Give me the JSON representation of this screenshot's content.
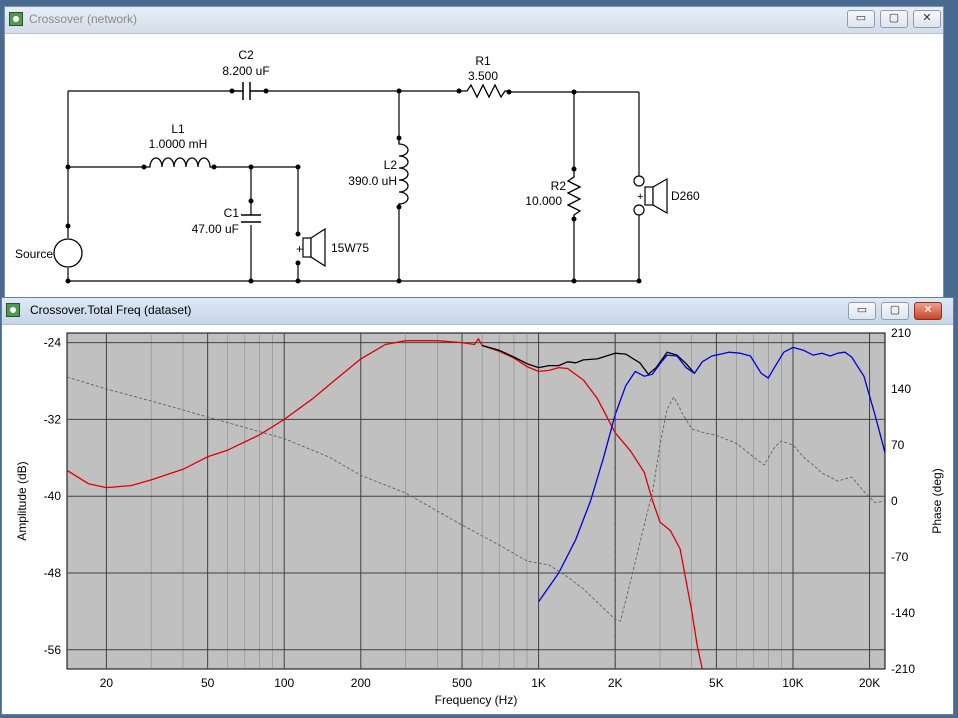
{
  "network_window": {
    "title": "Crossover (network)",
    "components": {
      "c2": {
        "name": "C2",
        "value": "8.200 uF"
      },
      "r1": {
        "name": "R1",
        "value": "3.500"
      },
      "l1": {
        "name": "L1",
        "value": "1.0000 mH"
      },
      "l2": {
        "name": "L2",
        "value": "390.0 uH"
      },
      "c1": {
        "name": "C1",
        "value": "47.00 uF"
      },
      "r2": {
        "name": "R2",
        "value": "10.000"
      },
      "source": {
        "name": "Source"
      },
      "woofer": {
        "name": "15W75"
      },
      "tweeter": {
        "name": "D260"
      }
    }
  },
  "plot_window": {
    "title": "Crossover.Total Freq (dataset)"
  },
  "window_buttons": {
    "minimize": "▭",
    "maximize": "▢",
    "close": "✕"
  },
  "chart_data": {
    "type": "line",
    "xlabel": "Frequency (Hz)",
    "ylabel_left": "Amplitude (dB)",
    "ylabel_right": "Phase (deg)",
    "x_scale": "log",
    "xlim": [
      14,
      23000
    ],
    "ylim_left": [
      -58,
      -23
    ],
    "ylim_right": [
      -210,
      210
    ],
    "x_ticks": [
      {
        "v": 20,
        "label": "20"
      },
      {
        "v": 50,
        "label": "50"
      },
      {
        "v": 100,
        "label": "100"
      },
      {
        "v": 200,
        "label": "200"
      },
      {
        "v": 500,
        "label": "500"
      },
      {
        "v": 1000,
        "label": "1K"
      },
      {
        "v": 2000,
        "label": "2K"
      },
      {
        "v": 5000,
        "label": "5K"
      },
      {
        "v": 10000,
        "label": "10K"
      },
      {
        "v": 20000,
        "label": "20K"
      }
    ],
    "y_ticks_left": [
      {
        "v": -24,
        "label": "-24"
      },
      {
        "v": -32,
        "label": "-32"
      },
      {
        "v": -40,
        "label": "-40"
      },
      {
        "v": -48,
        "label": "-48"
      },
      {
        "v": -56,
        "label": "-56"
      }
    ],
    "y_ticks_right": [
      {
        "v": 210,
        "label": "210"
      },
      {
        "v": 140,
        "label": "140"
      },
      {
        "v": 70,
        "label": "70"
      },
      {
        "v": 0,
        "label": "0"
      },
      {
        "v": -70,
        "label": "-70"
      },
      {
        "v": -140,
        "label": "-140"
      },
      {
        "v": -210,
        "label": "-210"
      }
    ],
    "grid": true,
    "background": "#c0c0c0",
    "series": [
      {
        "color": "#e00000",
        "axis": "left",
        "style": "solid",
        "points": [
          [
            14,
            -37.3
          ],
          [
            17,
            -38.7
          ],
          [
            20,
            -39.1
          ],
          [
            25,
            -38.9
          ],
          [
            30,
            -38.3
          ],
          [
            40,
            -37.2
          ],
          [
            50,
            -35.9
          ],
          [
            60,
            -35.2
          ],
          [
            80,
            -33.6
          ],
          [
            100,
            -32.0
          ],
          [
            130,
            -29.8
          ],
          [
            160,
            -27.8
          ],
          [
            200,
            -25.7
          ],
          [
            250,
            -24.2
          ],
          [
            300,
            -23.8
          ],
          [
            400,
            -23.8
          ],
          [
            500,
            -24.0
          ],
          [
            560,
            -24.2
          ],
          [
            580,
            -23.6
          ],
          [
            600,
            -24.3
          ],
          [
            700,
            -24.9
          ],
          [
            800,
            -25.6
          ],
          [
            900,
            -26.5
          ],
          [
            1000,
            -27.0
          ],
          [
            1100,
            -26.9
          ],
          [
            1200,
            -26.6
          ],
          [
            1300,
            -26.7
          ],
          [
            1500,
            -27.9
          ],
          [
            1700,
            -29.8
          ],
          [
            2000,
            -33.4
          ],
          [
            2300,
            -35.3
          ],
          [
            2600,
            -37.5
          ],
          [
            2800,
            -40.4
          ],
          [
            3000,
            -42.7
          ],
          [
            3300,
            -43.6
          ],
          [
            3600,
            -45.5
          ],
          [
            4000,
            -52.0
          ],
          [
            4200,
            -55.5
          ],
          [
            4400,
            -58.0
          ]
        ]
      },
      {
        "color": "#000000",
        "axis": "left",
        "style": "solid",
        "points": [
          [
            600,
            -24.3
          ],
          [
            700,
            -24.8
          ],
          [
            800,
            -25.5
          ],
          [
            900,
            -26.2
          ],
          [
            1000,
            -26.6
          ],
          [
            1100,
            -26.4
          ],
          [
            1200,
            -26.4
          ],
          [
            1300,
            -26.0
          ],
          [
            1400,
            -26.1
          ],
          [
            1500,
            -25.8
          ],
          [
            1700,
            -25.7
          ],
          [
            2000,
            -25.1
          ],
          [
            2200,
            -25.2
          ],
          [
            2500,
            -26.1
          ],
          [
            2700,
            -27.3
          ],
          [
            2900,
            -26.6
          ],
          [
            3200,
            -25.0
          ],
          [
            3500,
            -25.3
          ],
          [
            3800,
            -26.2
          ],
          [
            4100,
            -27.2
          ]
        ]
      },
      {
        "color": "#0000e0",
        "axis": "left",
        "style": "solid",
        "points": [
          [
            1000,
            -51.0
          ],
          [
            1200,
            -48.0
          ],
          [
            1400,
            -44.5
          ],
          [
            1600,
            -40.5
          ],
          [
            1800,
            -36.0
          ],
          [
            2000,
            -31.5
          ],
          [
            2200,
            -28.5
          ],
          [
            2400,
            -27.0
          ],
          [
            2600,
            -27.5
          ],
          [
            2800,
            -27.3
          ],
          [
            3000,
            -26.2
          ],
          [
            3200,
            -25.3
          ],
          [
            3500,
            -25.4
          ],
          [
            3800,
            -26.6
          ],
          [
            4100,
            -27.2
          ],
          [
            4400,
            -26.0
          ],
          [
            4800,
            -25.4
          ],
          [
            5200,
            -25.2
          ],
          [
            5600,
            -25.0
          ],
          [
            6200,
            -25.1
          ],
          [
            6800,
            -25.4
          ],
          [
            7500,
            -27.2
          ],
          [
            8000,
            -27.7
          ],
          [
            8500,
            -26.5
          ],
          [
            9200,
            -25.0
          ],
          [
            10000,
            -24.5
          ],
          [
            11000,
            -24.8
          ],
          [
            12000,
            -25.3
          ],
          [
            13000,
            -25.1
          ],
          [
            14000,
            -25.4
          ],
          [
            15000,
            -25.1
          ],
          [
            16000,
            -25.0
          ],
          [
            17000,
            -25.5
          ],
          [
            19000,
            -27.5
          ],
          [
            21000,
            -31.5
          ],
          [
            22500,
            -34.5
          ],
          [
            23000,
            -35.5
          ]
        ]
      },
      {
        "color": "#606060",
        "axis": "right",
        "style": "dashed",
        "points": [
          [
            14,
            155
          ],
          [
            20,
            140
          ],
          [
            30,
            125
          ],
          [
            50,
            105
          ],
          [
            100,
            78
          ],
          [
            150,
            55
          ],
          [
            200,
            32
          ],
          [
            300,
            10
          ],
          [
            500,
            -30
          ],
          [
            700,
            -55
          ],
          [
            900,
            -75
          ],
          [
            1100,
            -80
          ],
          [
            1300,
            -95
          ],
          [
            1500,
            -110
          ],
          [
            2000,
            -148
          ],
          [
            2100,
            -150
          ],
          [
            2300,
            -100
          ],
          [
            2600,
            -30
          ],
          [
            2800,
            10
          ],
          [
            3000,
            70
          ],
          [
            3200,
            115
          ],
          [
            3400,
            130
          ],
          [
            3700,
            108
          ],
          [
            4000,
            90
          ],
          [
            4500,
            85
          ],
          [
            5000,
            82
          ],
          [
            6000,
            72
          ],
          [
            7000,
            55
          ],
          [
            7700,
            45
          ],
          [
            8500,
            68
          ],
          [
            9000,
            75
          ],
          [
            10000,
            70
          ],
          [
            11000,
            55
          ],
          [
            12000,
            45
          ],
          [
            13000,
            35
          ],
          [
            15000,
            25
          ],
          [
            17000,
            30
          ],
          [
            19000,
            12
          ],
          [
            21000,
            -2
          ],
          [
            23000,
            0
          ]
        ]
      }
    ]
  }
}
